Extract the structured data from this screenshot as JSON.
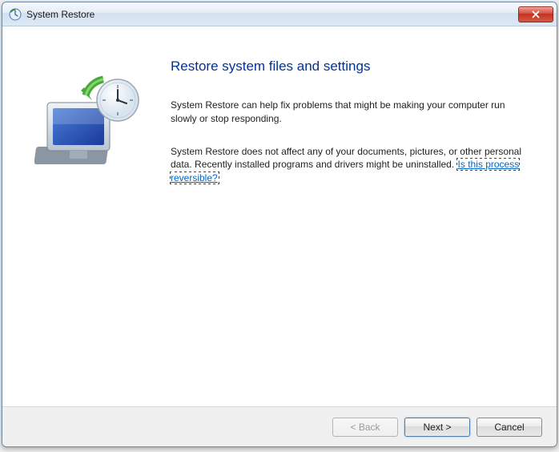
{
  "titlebar": {
    "title": "System Restore"
  },
  "content": {
    "heading": "Restore system files and settings",
    "para1": "System Restore can help fix problems that might be making your computer run slowly or stop responding.",
    "para2_a": "System Restore does not affect any of your documents, pictures, or other personal data. Recently installed programs and drivers might be uninstalled. ",
    "para2_link": "Is this process reversible?"
  },
  "buttons": {
    "back": "< Back",
    "next": "Next >",
    "cancel": "Cancel"
  }
}
